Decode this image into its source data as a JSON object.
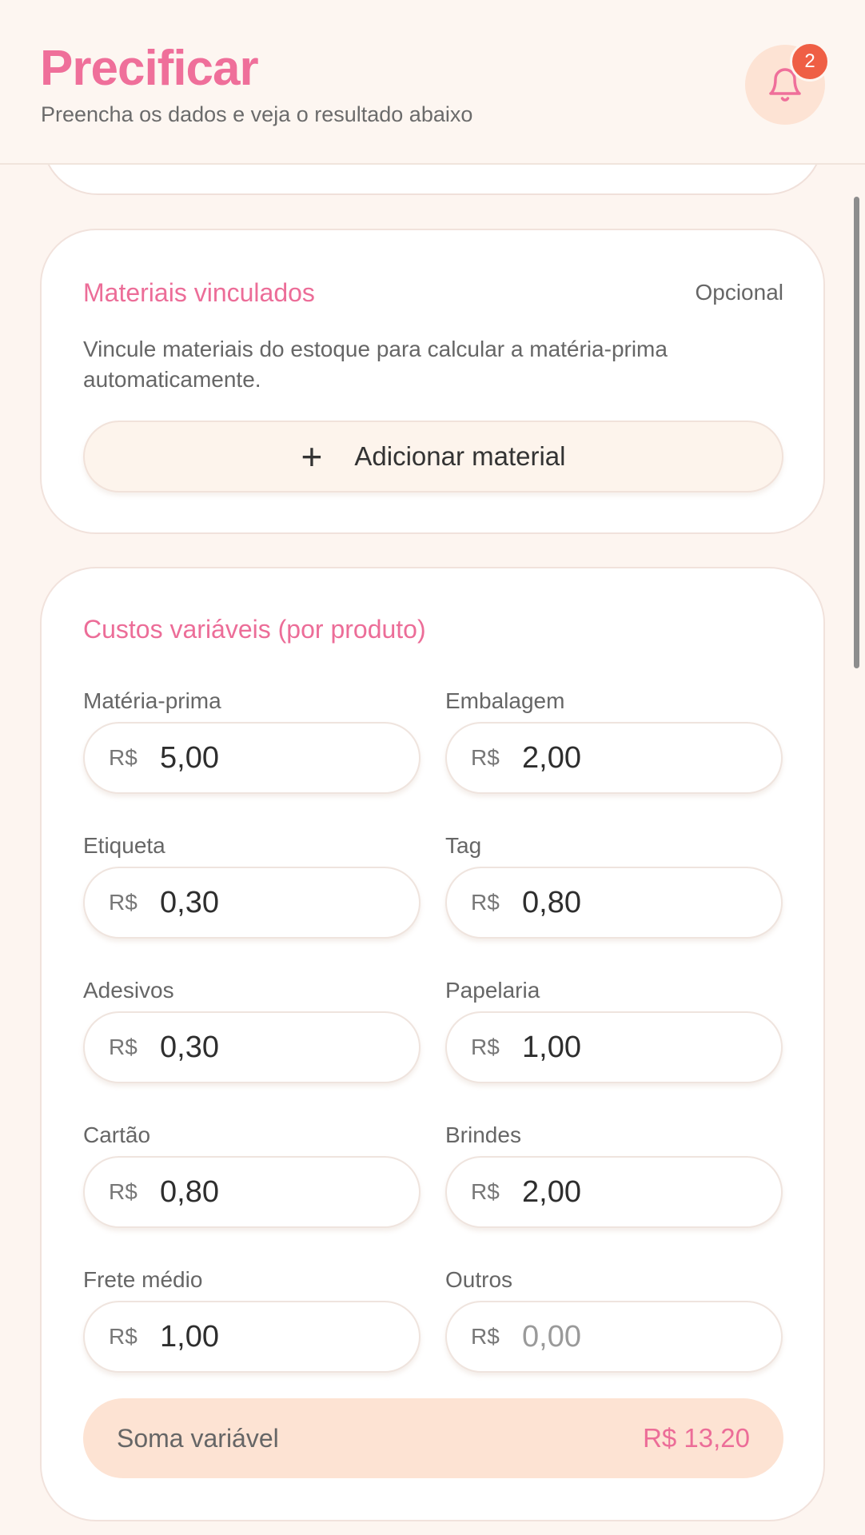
{
  "header": {
    "title": "Precificar",
    "subtitle": "Preencha os dados e veja o resultado abaixo",
    "notification_count": "2"
  },
  "materials": {
    "title": "Materiais vinculados",
    "optional": "Opcional",
    "description": "Vincule materiais do estoque para calcular a matéria-prima automaticamente.",
    "add_button": "Adicionar material"
  },
  "costs": {
    "title": "Custos variáveis (por produto)",
    "currency": "R$",
    "fields": [
      {
        "label": "Matéria-prima",
        "value": "5,00"
      },
      {
        "label": "Embalagem",
        "value": "2,00"
      },
      {
        "label": "Etiqueta",
        "value": "0,30"
      },
      {
        "label": "Tag",
        "value": "0,80"
      },
      {
        "label": "Adesivos",
        "value": "0,30"
      },
      {
        "label": "Papelaria",
        "value": "1,00"
      },
      {
        "label": "Cartão",
        "value": "0,80"
      },
      {
        "label": "Brindes",
        "value": "2,00"
      },
      {
        "label": "Frete médio",
        "value": "1,00"
      },
      {
        "label": "Outros",
        "value": "",
        "placeholder": "0,00"
      }
    ],
    "sum_label": "Soma variável",
    "sum_value": "R$ 13,20"
  },
  "colors": {
    "accent": "#ec6d98",
    "badge": "#ef5f45",
    "background": "#fdf5f0",
    "sum_background": "#fde3d3"
  }
}
